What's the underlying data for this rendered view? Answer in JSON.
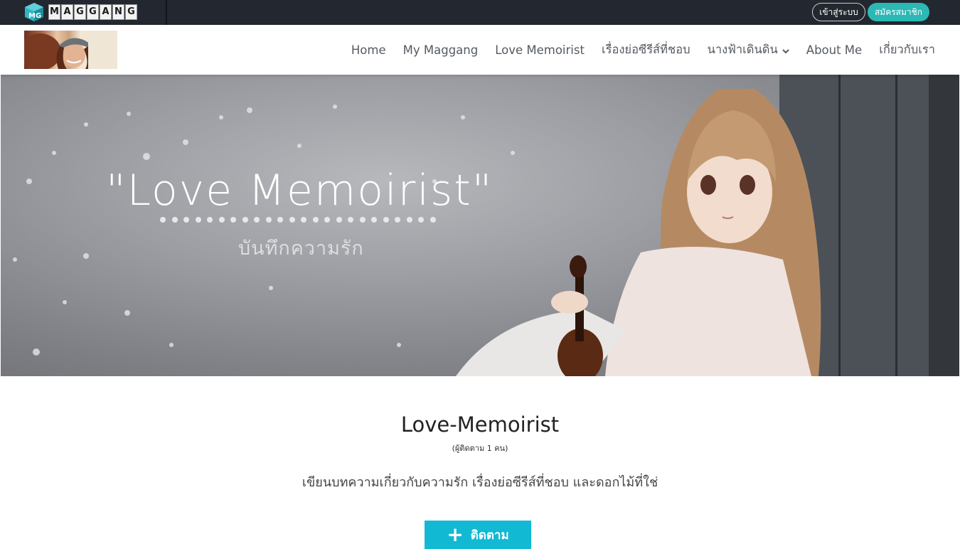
{
  "topbar": {
    "logo_mark": "MG",
    "logo_letters": [
      "M",
      "A",
      "G",
      "G",
      "A",
      "N",
      "G"
    ],
    "login_label": "เข้าสู่ระบบ",
    "signup_label": "สมัครสมาชิก",
    "accent_color": "#2cb8b5"
  },
  "nav": {
    "items": [
      {
        "label": "Home"
      },
      {
        "label": "My Maggang"
      },
      {
        "label": "Love Memoirist"
      },
      {
        "label": "เรื่องย่อซีรีส์ที่ชอบ"
      },
      {
        "label": "นางฟ้าเดินดิน",
        "has_dropdown": true
      },
      {
        "label": "About Me"
      },
      {
        "label": "เกี่ยวกับเรา"
      }
    ]
  },
  "hero": {
    "title": "\"Love Memoirist\"",
    "subtitle": "บันทึกความรัก"
  },
  "blog": {
    "title": "Love-Memoirist",
    "followers": "(ผู้ติดตาม 1 คน)",
    "description": "เขียนบทความเกี่ยวกับความรัก เรื่องย่อซีรีส์ที่ชอบ และดอกไม้ที่ใช่",
    "follow_label": "ติดตาม",
    "follow_color": "#12b9d3"
  }
}
